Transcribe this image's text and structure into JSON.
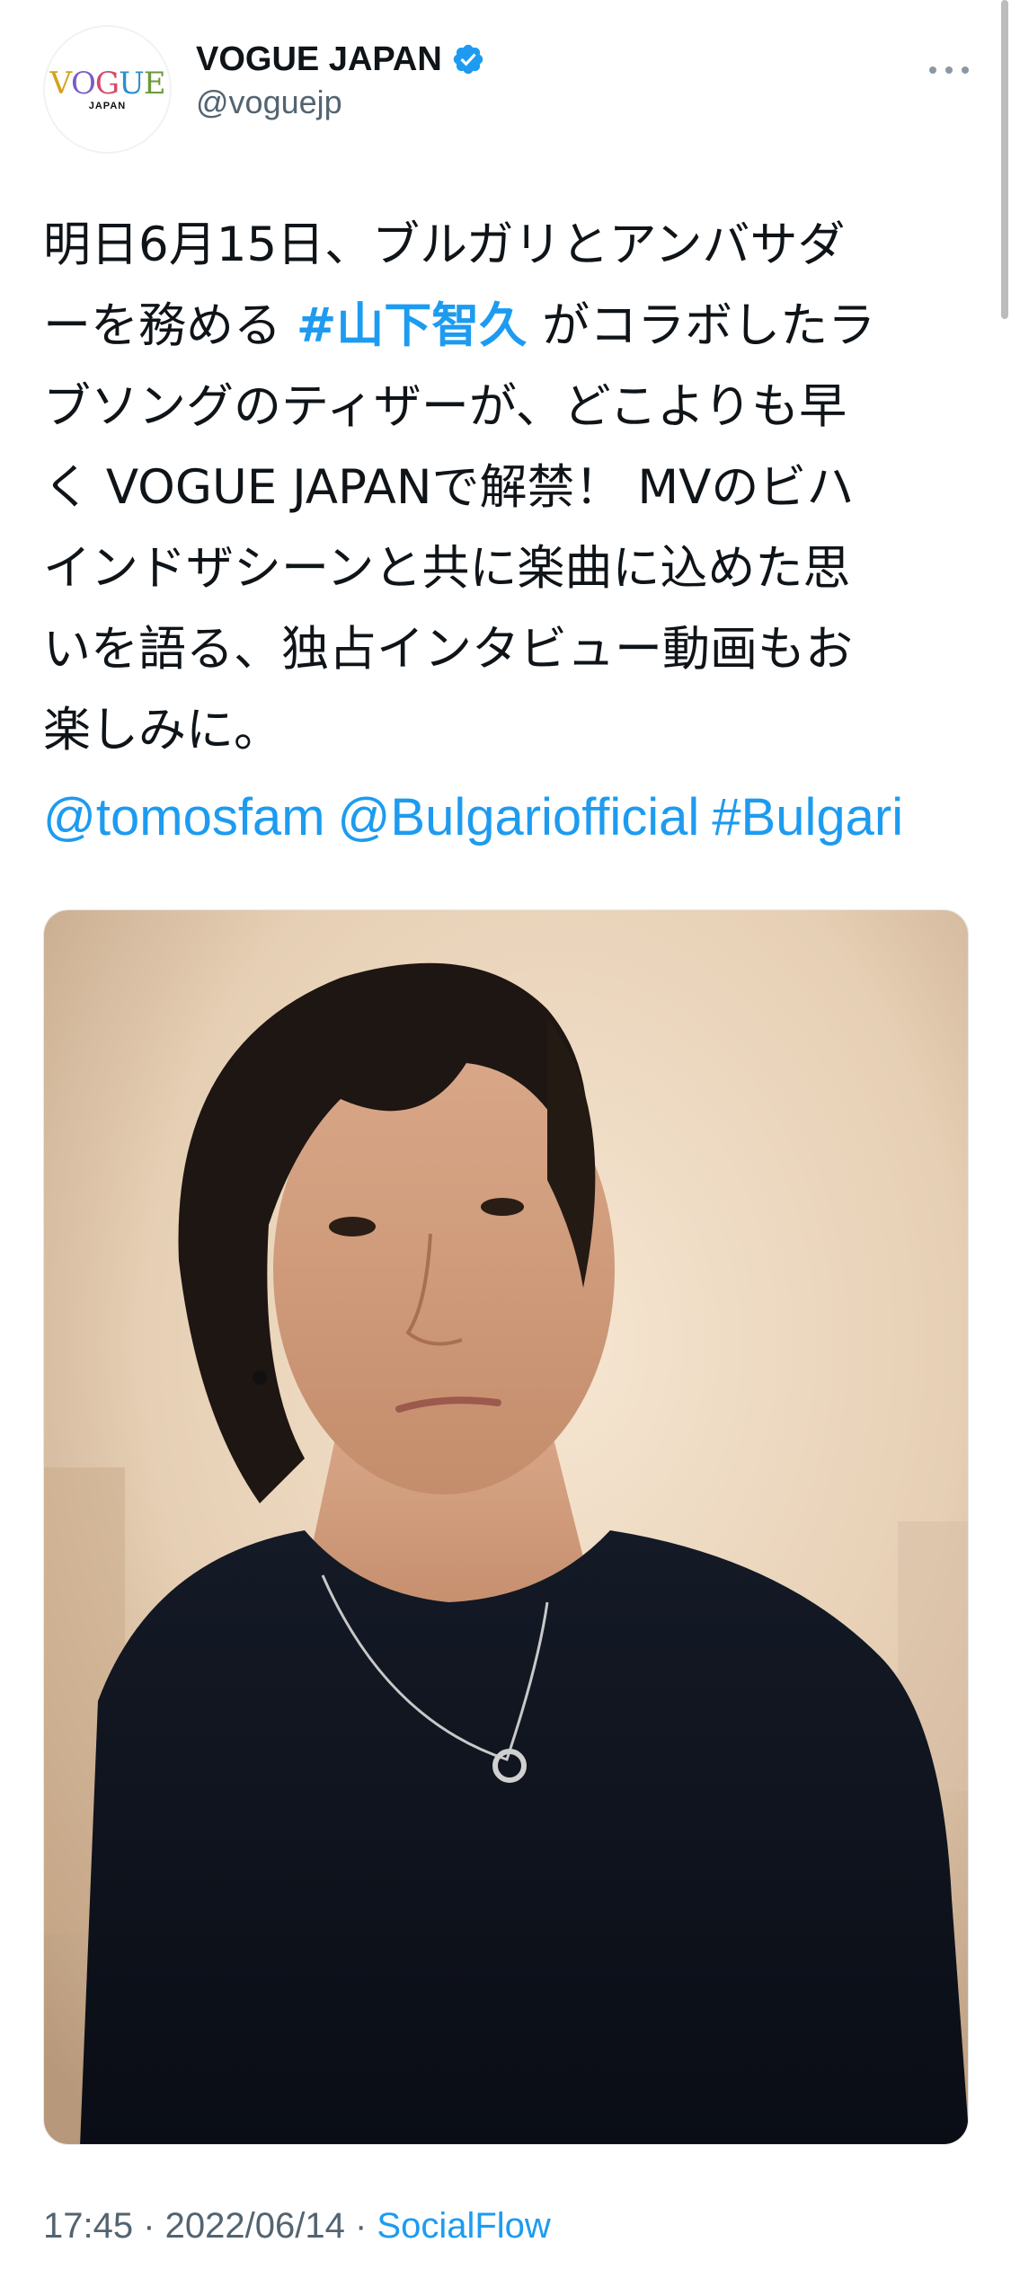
{
  "account": {
    "display_name": "VOGUE JAPAN",
    "handle": "@voguejp",
    "avatar_logo_text": "VOGUE",
    "avatar_logo_subtext": "JAPAN",
    "verified_badge_color": "#1d9bf0"
  },
  "tweet": {
    "lines": [
      {
        "pre": "明日6月15日、ブルガリとアンバサダ",
        "tag": "",
        "post": ""
      },
      {
        "pre": "ーを務める ",
        "tag": "#山下智久",
        "post": " がコラボしたラ"
      },
      {
        "pre": "ブソングのティザーが、どこよりも早",
        "tag": "",
        "post": ""
      },
      {
        "pre": "く VOGUE JAPANで解禁！ MVのビハ",
        "tag": "",
        "post": ""
      },
      {
        "pre": "インドザシーンと共に楽曲に込めた思",
        "tag": "",
        "post": ""
      },
      {
        "pre": "いを語る、独占インタビュー動画もお",
        "tag": "",
        "post": ""
      },
      {
        "pre": "楽しみに。",
        "tag": "",
        "post": ""
      }
    ],
    "links": [
      "@tomosfam",
      "@Bulgariofficial",
      "#Bulgari"
    ]
  },
  "meta": {
    "time": "17:45",
    "separator": " · ",
    "date": "2022/06/14",
    "source": "SocialFlow"
  },
  "colors": {
    "link": "#1d9bf0",
    "text": "#0f1419",
    "secondary": "#536471"
  }
}
